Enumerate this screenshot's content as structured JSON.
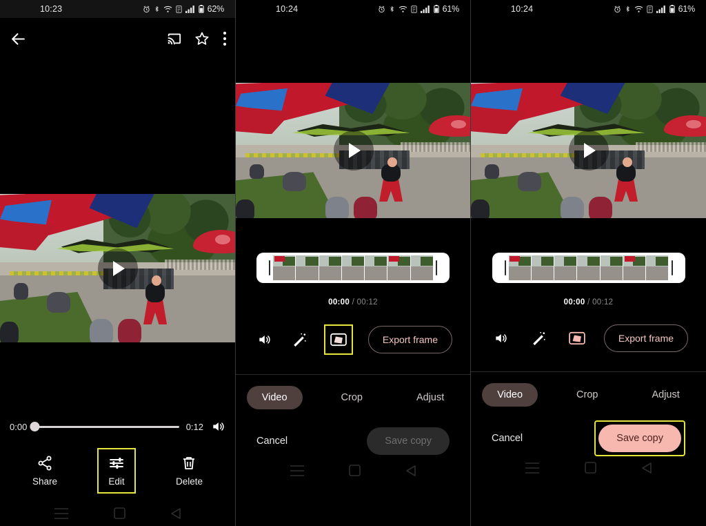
{
  "panels": [
    {
      "id": "player",
      "status": {
        "time": "10:23",
        "battery": "62%"
      },
      "topbar": {
        "back": "back-arrow",
        "cast": "cast",
        "favorite": "star",
        "overflow": "more-options"
      },
      "player": {
        "current_time": "0:00",
        "total_time": "0:12",
        "volume": "volume-on",
        "play": "play"
      },
      "actions": [
        {
          "label": "Share",
          "icon": "share-icon",
          "highlighted": false
        },
        {
          "label": "Edit",
          "icon": "tune-icon",
          "highlighted": true
        },
        {
          "label": "Delete",
          "icon": "trash-icon",
          "highlighted": false
        }
      ]
    },
    {
      "id": "editor-before",
      "status": {
        "time": "10:24",
        "battery": "61%"
      },
      "trim": {
        "current_time": "00:00",
        "separator": "/",
        "total_time": "00:12"
      },
      "tools": [
        {
          "name": "volume-icon",
          "active": false,
          "highlighted": false
        },
        {
          "name": "enhance-icon",
          "active": false,
          "highlighted": false
        },
        {
          "name": "stabilize-icon",
          "active": false,
          "highlighted": true
        }
      ],
      "export_label": "Export frame",
      "tabs": [
        {
          "label": "Video",
          "active": true
        },
        {
          "label": "Crop",
          "active": false
        },
        {
          "label": "Adjust",
          "active": false
        }
      ],
      "cancel_label": "Cancel",
      "save_label": "Save copy",
      "save_enabled": false,
      "save_highlighted": false
    },
    {
      "id": "editor-after",
      "status": {
        "time": "10:24",
        "battery": "61%"
      },
      "trim": {
        "current_time": "00:00",
        "separator": "/",
        "total_time": "00:12"
      },
      "tools": [
        {
          "name": "volume-icon",
          "active": false,
          "highlighted": false
        },
        {
          "name": "enhance-icon",
          "active": false,
          "highlighted": false
        },
        {
          "name": "stabilize-icon",
          "active": true,
          "highlighted": false
        }
      ],
      "export_label": "Export frame",
      "tabs": [
        {
          "label": "Video",
          "active": true
        },
        {
          "label": "Crop",
          "active": false
        },
        {
          "label": "Adjust",
          "active": false
        }
      ],
      "cancel_label": "Cancel",
      "save_label": "Save copy",
      "save_enabled": true,
      "save_highlighted": true
    }
  ],
  "navbar": {
    "recents": "recents-icon",
    "home": "home-icon",
    "back": "back-icon"
  },
  "colors": {
    "highlight": "#e6e63c",
    "accent_pink": "#f7b8b0",
    "tab_active_bg": "#4f403e",
    "background": "#000000"
  }
}
